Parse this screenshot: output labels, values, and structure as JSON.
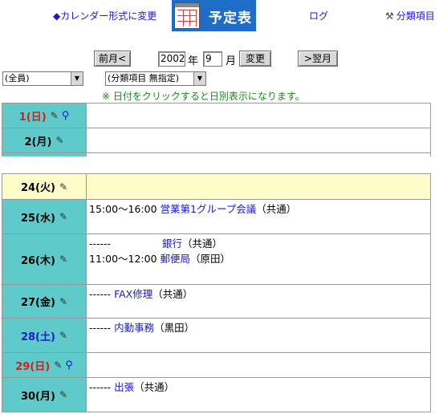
{
  "header": {
    "calendar_link": "◆カレンダー形式に変更",
    "title": "予定表",
    "log_link": "ログ",
    "category_link": "分類項目"
  },
  "nav": {
    "prev_label": "前月<",
    "year_value": "2002",
    "year_unit": "年",
    "month_value": "9",
    "month_unit": "月",
    "change_label": "変更",
    "next_label": ">翌月"
  },
  "filters": {
    "member_select": "(全員)",
    "category_select": "(分類項目 無指定)"
  },
  "note": "※ 日付をクリックすると日別表示になります。",
  "days": [
    {
      "label": "1(日)",
      "type": "sun",
      "search": true,
      "events": []
    },
    {
      "label": "2(月)",
      "type": "weekday",
      "search": false,
      "events": []
    },
    {
      "label": "24(火)",
      "type": "today",
      "search": false,
      "events": []
    },
    {
      "label": "25(水)",
      "type": "weekday",
      "search": false,
      "events": [
        {
          "time": "15:00～16:00",
          "title": "営業第1グループ会議",
          "who": "（共通）"
        }
      ]
    },
    {
      "label": "26(木)",
      "type": "weekday",
      "search": false,
      "events": [
        {
          "time": "------",
          "title": "銀行",
          "who": "（共通）"
        },
        {
          "time": "11:00～12:00",
          "title": "郵便局",
          "who": "（原田）"
        }
      ]
    },
    {
      "label": "27(金)",
      "type": "weekday",
      "search": false,
      "events": [
        {
          "time": "------",
          "title": "FAX修理",
          "who": "（共通）"
        }
      ]
    },
    {
      "label": "28(土)",
      "type": "sat",
      "search": false,
      "events": [
        {
          "time": "------",
          "title": "内勤事務",
          "who": "（黒田）"
        }
      ]
    },
    {
      "label": "29(日)",
      "type": "sun",
      "search": true,
      "events": []
    },
    {
      "label": "30(月)",
      "type": "weekday",
      "search": false,
      "events": [
        {
          "time": "------",
          "title": "出張",
          "who": "（共通）"
        }
      ]
    }
  ],
  "icons": {
    "edit": "pencil-icon",
    "search": "magnifier-icon",
    "category": "tools-icon"
  },
  "colors": {
    "day_cell": "#5fcaca",
    "today": "#fefcc8",
    "sunday": "#d21e1e",
    "saturday": "#1a1ad0",
    "link": "#1a1ad0",
    "note": "#1a8a1a",
    "title_bg": "#1e6ec8"
  }
}
